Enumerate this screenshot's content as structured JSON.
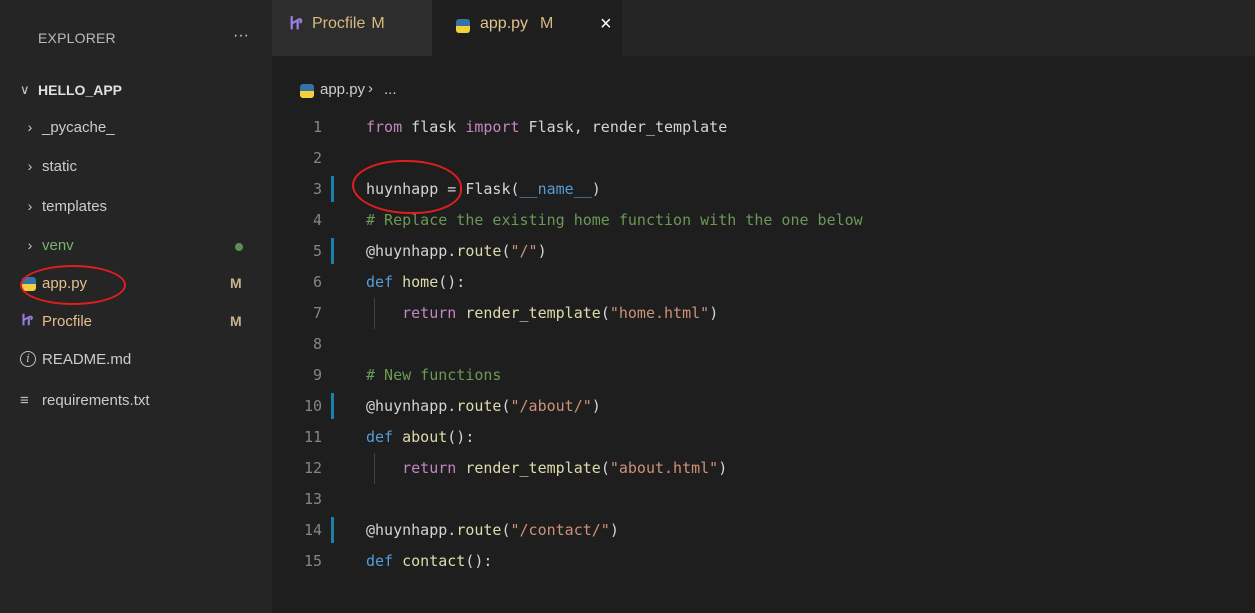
{
  "sidebar": {
    "title": "EXPLORER",
    "more_actions": "···",
    "root_folder": "HELLO_APP",
    "items": [
      {
        "label": "_pycache_",
        "type": "folder",
        "glyph": "›"
      },
      {
        "label": "static",
        "type": "folder",
        "glyph": "›"
      },
      {
        "label": "templates",
        "type": "folder",
        "glyph": "›"
      },
      {
        "label": "venv",
        "type": "folder",
        "glyph": "›"
      },
      {
        "label": "app.py",
        "type": "python-file",
        "badge": "M"
      },
      {
        "label": "Procfile",
        "type": "heroku-file",
        "badge": "M"
      },
      {
        "label": "README.md",
        "type": "info-file"
      },
      {
        "label": "requirements.txt",
        "type": "text-file"
      }
    ]
  },
  "tabs": [
    {
      "label": "Procfile",
      "status": "M",
      "icon": "heroku-icon"
    },
    {
      "label": "app.py",
      "status": "M",
      "icon": "python-icon",
      "active": true,
      "close": "×"
    }
  ],
  "breadcrumb": {
    "file": "app.py",
    "separator": "›",
    "more": "..."
  },
  "colors": {
    "annotation": "#e01e1e",
    "modified": "#d7ba7d",
    "gutter_change": "#1b81a8"
  },
  "code": {
    "lines": [
      {
        "n": "1",
        "t": "from flask import Flask, render_template"
      },
      {
        "n": "2",
        "t": ""
      },
      {
        "n": "3",
        "t": "huynhapp = Flask(__name__)"
      },
      {
        "n": "4",
        "t": "# Replace the existing home function with the one below"
      },
      {
        "n": "5",
        "t": "@huynhapp.route(\"/\")"
      },
      {
        "n": "6",
        "t": "def home():"
      },
      {
        "n": "7",
        "t": "    return render_template(\"home.html\")"
      },
      {
        "n": "8",
        "t": ""
      },
      {
        "n": "9",
        "t": "# New functions"
      },
      {
        "n": "10",
        "t": "@huynhapp.route(\"/about/\")"
      },
      {
        "n": "11",
        "t": "def about():"
      },
      {
        "n": "12",
        "t": "    return render_template(\"about.html\")"
      },
      {
        "n": "13",
        "t": ""
      },
      {
        "n": "14",
        "t": "@huynhapp.route(\"/contact/\")"
      },
      {
        "n": "15",
        "t": "def contact():"
      }
    ]
  }
}
